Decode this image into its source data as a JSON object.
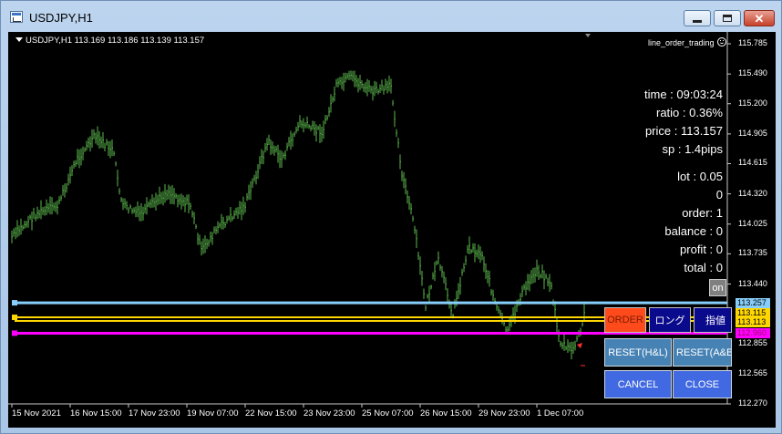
{
  "window": {
    "title": "USDJPY,H1",
    "min_glyph": "—",
    "close_glyph": "✕"
  },
  "chart": {
    "header": "USDJPY,H1  113.169 113.186 113.139 113.157",
    "indicator": "line_order_trading",
    "price_axis": [
      "115.785",
      "115.490",
      "115.200",
      "114.905",
      "114.615",
      "114.320",
      "114.025",
      "113.735",
      "113.440",
      "113.150",
      "112.855",
      "112.565",
      "112.270"
    ],
    "time_axis": [
      "15 Nov 2021",
      "16 Nov 15:00",
      "17 Nov 23:00",
      "19 Nov 07:00",
      "22 Nov 15:00",
      "23 Nov 23:00",
      "25 Nov 07:00",
      "26 Nov 15:00",
      "29 Nov 23:00",
      "1 Dec 07:00"
    ],
    "lines": {
      "upper": {
        "label": "113.257",
        "color": "#87cefa"
      },
      "gold1": {
        "label": "113.115",
        "color": "#ffd700"
      },
      "gold2": {
        "label": "113.113",
        "color": "#ffd700"
      },
      "lower": {
        "label": "112.960",
        "color": "#ff00ff"
      }
    },
    "bar_color": "#5db84b"
  },
  "panel": {
    "time": "time : 09:03:24",
    "ratio": "ratio : 0.36%",
    "price": "price : 113.157",
    "sp": "sp : 1.4pips",
    "lot": "lot : 0.05",
    "lot_value": "0",
    "order": "order: 1",
    "balance": "balance : 0",
    "profit": "profit : 0",
    "total": "total : 0",
    "on_label": "on"
  },
  "buttons": {
    "order": "ORDER",
    "long": "ロング",
    "limit": "指値",
    "reset_hl": "RESET(H&L)",
    "reset_ab": "RESET(A&B)",
    "cancel": "CANCEL",
    "close": "CLOSE"
  }
}
